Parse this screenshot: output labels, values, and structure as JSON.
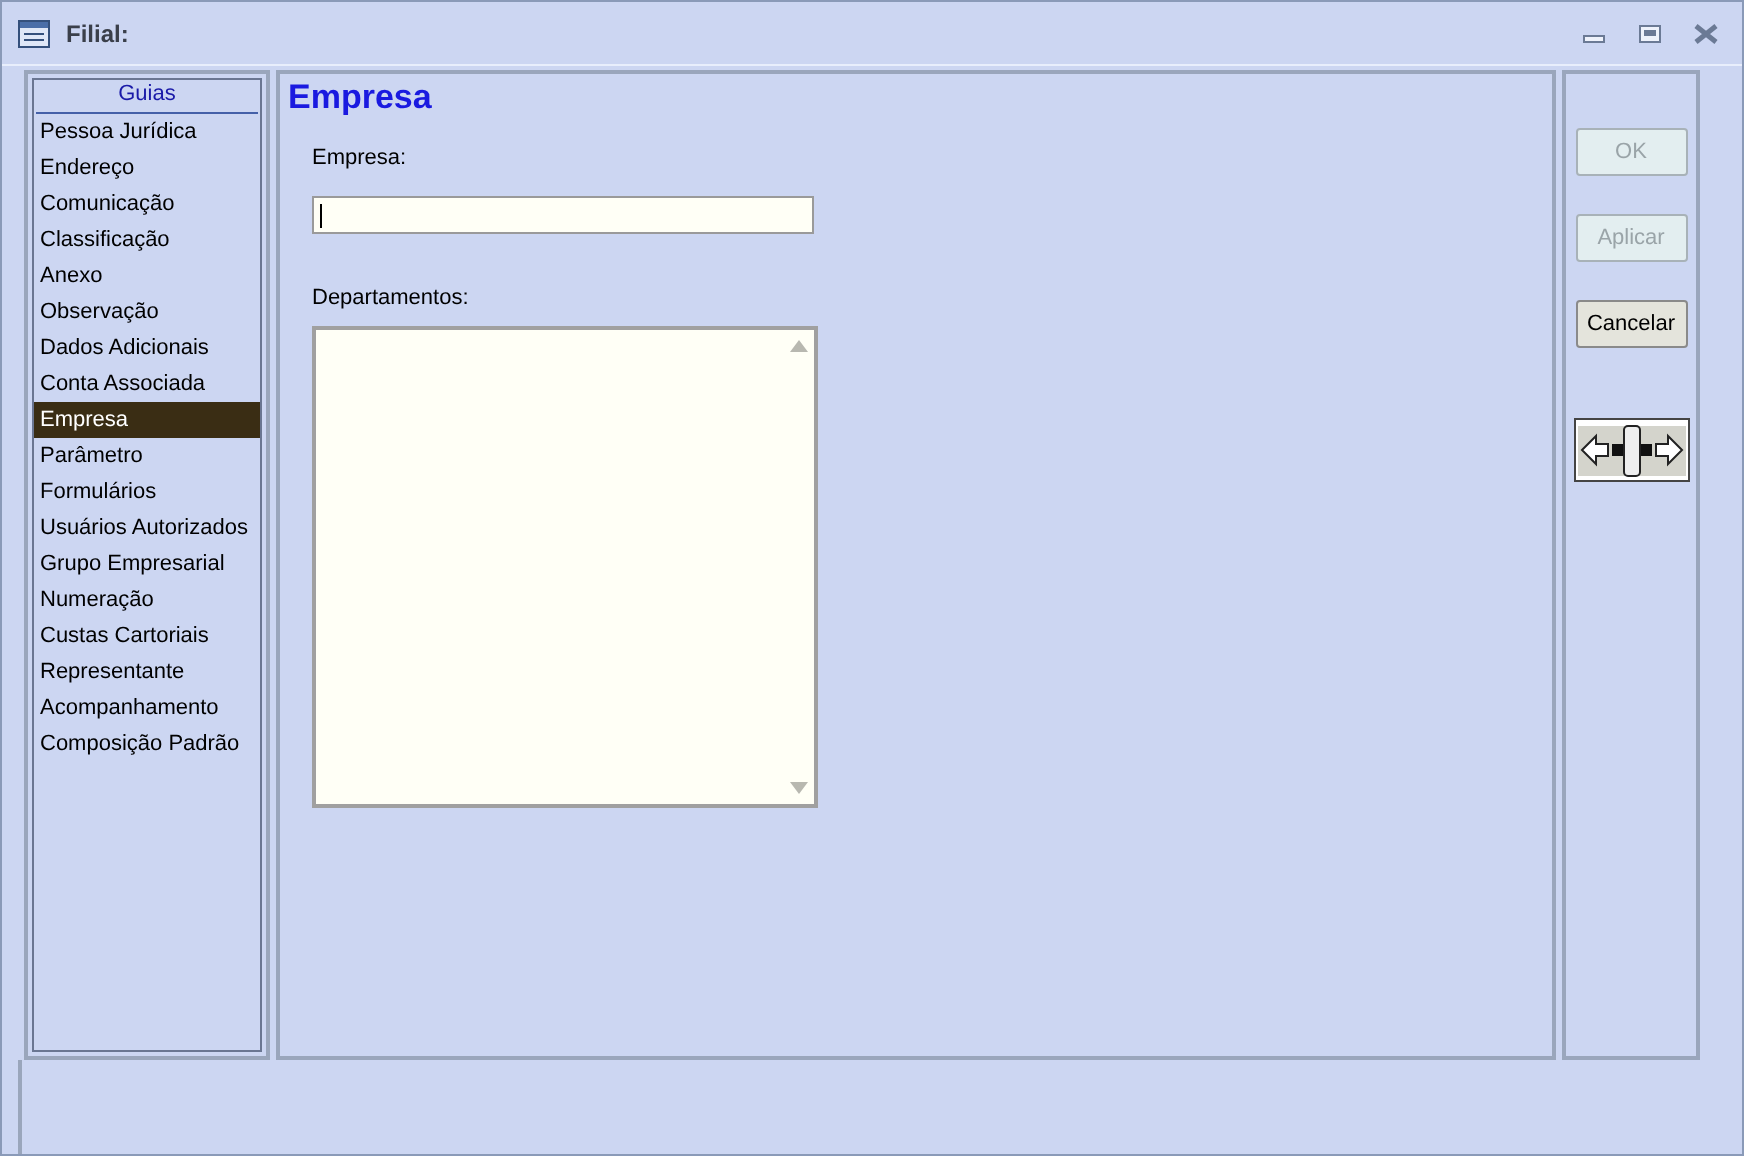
{
  "window": {
    "title": "Filial:"
  },
  "sidebar": {
    "header": "Guias",
    "items": [
      {
        "label": "Pessoa Jurídica",
        "selected": false
      },
      {
        "label": "Endereço",
        "selected": false
      },
      {
        "label": "Comunicação",
        "selected": false
      },
      {
        "label": "Classificação",
        "selected": false
      },
      {
        "label": "Anexo",
        "selected": false
      },
      {
        "label": "Observação",
        "selected": false
      },
      {
        "label": "Dados Adicionais",
        "selected": false
      },
      {
        "label": "Conta Associada",
        "selected": false
      },
      {
        "label": "Empresa",
        "selected": true
      },
      {
        "label": "Parâmetro",
        "selected": false
      },
      {
        "label": "Formulários",
        "selected": false
      },
      {
        "label": "Usuários Autorizados",
        "selected": false
      },
      {
        "label": "Grupo Empresarial",
        "selected": false
      },
      {
        "label": "Numeração",
        "selected": false
      },
      {
        "label": "Custas Cartoriais",
        "selected": false
      },
      {
        "label": "Representante",
        "selected": false
      },
      {
        "label": "Acompanhamento",
        "selected": false
      },
      {
        "label": "Composição Padrão",
        "selected": false
      }
    ]
  },
  "content": {
    "title": "Empresa",
    "empresa_label": "Empresa:",
    "departamentos_label": "Departamentos:"
  },
  "buttons": [
    {
      "label": "OK",
      "disabled": true
    },
    {
      "label": "Aplicar",
      "disabled": true
    },
    {
      "label": "Cancelar",
      "disabled": false
    }
  ]
}
